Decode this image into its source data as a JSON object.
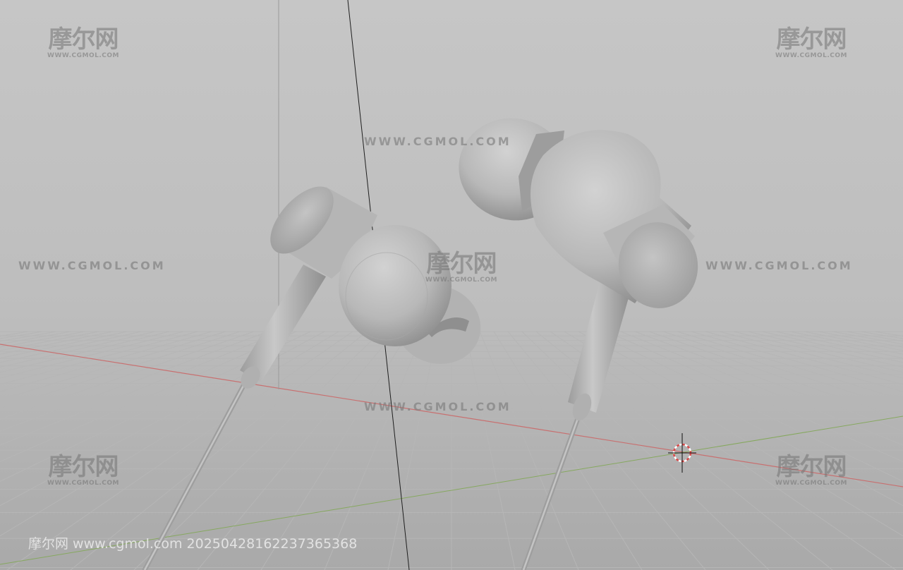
{
  "viewport": {
    "background_top": "#c6c6c6",
    "background_bottom": "#a8a8a8",
    "grid_color": "#b4b4b4",
    "x_axis_color": "#c46a6a",
    "y_axis_color": "#7fa35a"
  },
  "model": {
    "name": "earphones",
    "body_color": "#bcbcbc",
    "shadow_color": "#8c8c8c"
  },
  "watermarks": {
    "logo_text": "摩尔网",
    "logo_url": "WWW.CGMOL.COM",
    "url_text": "WWW.CGMOL.COM",
    "footer": "摩尔网 www.cgmol.com 20250428162237365368"
  },
  "cursor": {
    "icon": "3d-cursor-icon",
    "ring_color": "#d94a4a"
  }
}
